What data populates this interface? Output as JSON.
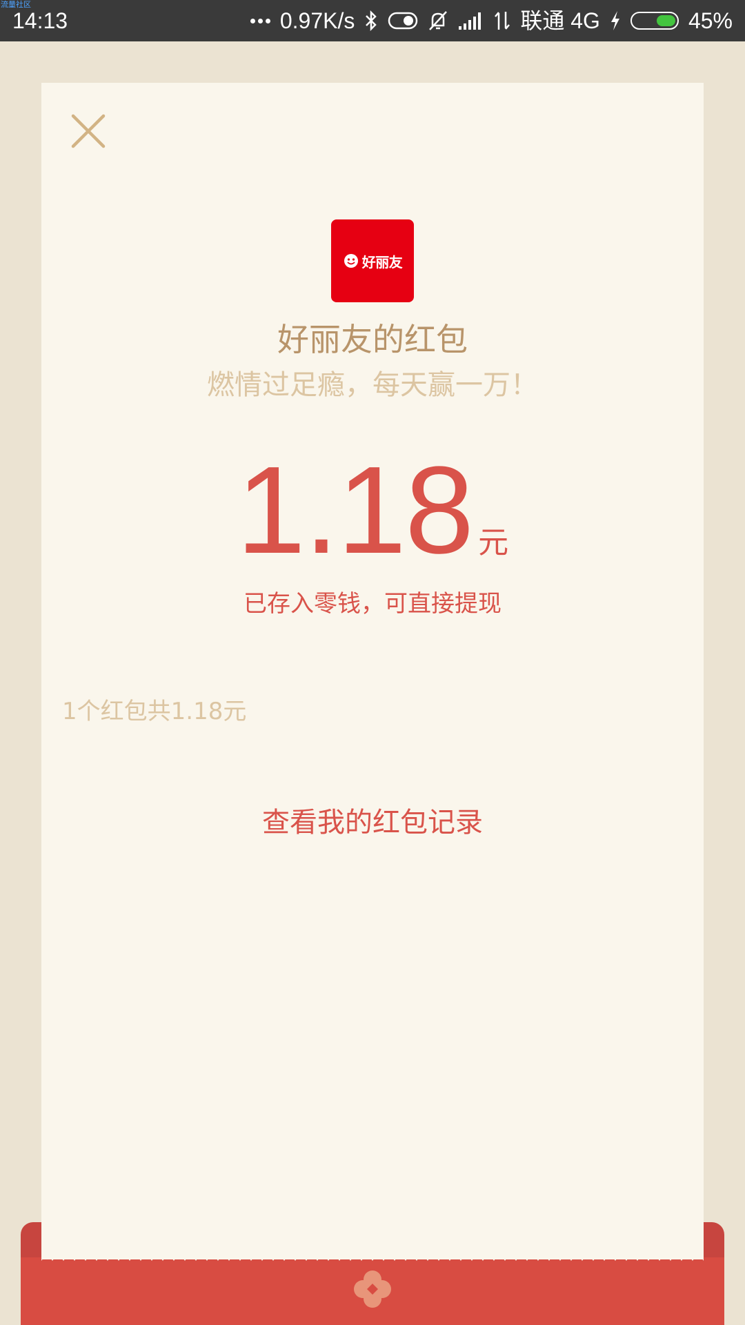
{
  "status_bar": {
    "watermark": "流量社区",
    "time": "14:13",
    "net_speed": "0.97K/s",
    "carrier": "联通 4G",
    "battery_percent": "45%",
    "battery_level": 0.45,
    "icons": [
      "more-dots-icon",
      "bluetooth-icon",
      "toggle-icon",
      "mute-bell-icon",
      "signal-icon",
      "data-arrows-icon",
      "charging-bolt-icon",
      "battery-icon"
    ],
    "battery_color": "#43c43f"
  },
  "packet": {
    "close_icon": "close-icon",
    "logo_text": "好丽友",
    "sender_title": "好丽友的红包",
    "blessing": "燃情过足瘾，每天赢一万！",
    "amount": "1.18",
    "amount_unit": "元",
    "saved_note": "已存入零钱，可直接提现",
    "summary": "1个红包共1.18元",
    "records_link": "查看我的红包记录"
  },
  "colors": {
    "background": "#ebe3d2",
    "card": "#faf6ec",
    "accent_red": "#d9534a",
    "gold_text": "#b8946a",
    "pale_gold_text": "#dcc5a2",
    "logo_red": "#e60012",
    "envelope_red": "#d84c42"
  }
}
